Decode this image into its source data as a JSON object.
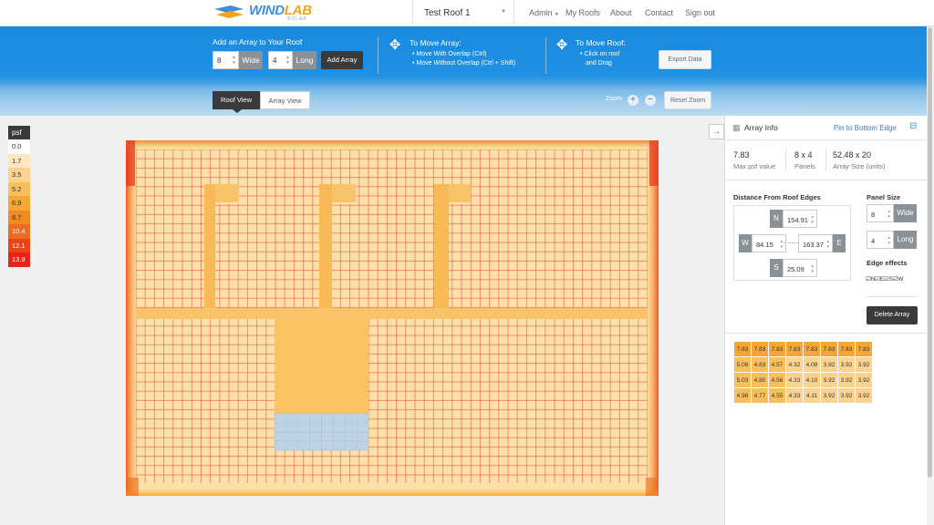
{
  "app": {
    "logo_text_a": "WIND",
    "logo_text_b": "LAB",
    "logo_sub": "SOLAR",
    "roof_select": "Test Roof 1",
    "nav": [
      "Admin",
      "My Roofs",
      "About",
      "Contact",
      "Sign out"
    ]
  },
  "toolbar": {
    "add_title": "Add an Array to Your Roof",
    "wide_value": "8",
    "wide_label": "Wide",
    "long_value": "4",
    "long_label": "Long",
    "add_button": "Add Array",
    "move_array_title": "To Move Array:",
    "move_array_1": "Move With Overlap (Ctrl)",
    "move_array_2": "Move Without Overlap (Ctrl + Shift)",
    "move_roof_title": "To Move Roof:",
    "move_roof_1": "Click on roof",
    "move_roof_2": "and Drag",
    "export_button": "Export Data",
    "tab_roof": "Roof View",
    "tab_array": "Array View",
    "zoom_label": "Zoom",
    "zoom_in": "+",
    "zoom_out": "−",
    "reset_zoom": "Reset Zoom"
  },
  "legend": {
    "title": "psf",
    "items": [
      {
        "label": "0.0",
        "color": "#ffffff"
      },
      {
        "label": "1.7",
        "color": "#fde7c2"
      },
      {
        "label": "3.5",
        "color": "#fbd38f"
      },
      {
        "label": "5.2",
        "color": "#f9bf5c"
      },
      {
        "label": "6.9",
        "color": "#f6a733"
      },
      {
        "label": "8.7",
        "color": "#f28a22"
      },
      {
        "label": "10.4",
        "color": "#ee6a1c"
      },
      {
        "label": "12.1",
        "color": "#ea4519"
      },
      {
        "label": "13.9",
        "color": "#e62517"
      }
    ]
  },
  "panel": {
    "title": "Array Info",
    "pin_link": "Pin to Bottom Edge",
    "max_psf": "7.83",
    "max_psf_label": "Max psf value",
    "panels": "8 x 4",
    "panels_label": "Panels",
    "array_size": "52.48 x 20",
    "array_size_label": "Array Size (units)",
    "dist_title": "Distance From Roof Edges",
    "north_tag": "N",
    "north": "154.91",
    "west_tag": "W",
    "west": "84.15",
    "east": "163.37",
    "east_tag": "E",
    "south_tag": "S",
    "south": "25.09",
    "panel_size_title": "Panel Size",
    "ps_wide": "8",
    "ps_wide_label": "Wide",
    "ps_long": "4",
    "ps_long_label": "Long",
    "edge_title": "Edge effects",
    "edge_checks": "☑N☑E☑S☑W",
    "delete_button": "Delete Array"
  },
  "psf_table": [
    [
      "7.83",
      "7.83",
      "7.83",
      "7.83",
      "7.83",
      "7.83",
      "7.83",
      "7.83"
    ],
    [
      "5.08",
      "4.83",
      "4.57",
      "4.32",
      "4.08",
      "3.92",
      "3.92",
      "3.92"
    ],
    [
      "5.03",
      "4.80",
      "4.56",
      "4.33",
      "4.10",
      "3.92",
      "3.92",
      "3.92"
    ],
    [
      "4.98",
      "4.77",
      "4.55",
      "4.33",
      "4.11",
      "3.92",
      "3.92",
      "3.92"
    ]
  ],
  "colors": {
    "accent": "#1f8fe2",
    "grid_line": "#e8563c",
    "roof_fill": "#fde0a8",
    "array_fill": "#bcd3e6"
  }
}
